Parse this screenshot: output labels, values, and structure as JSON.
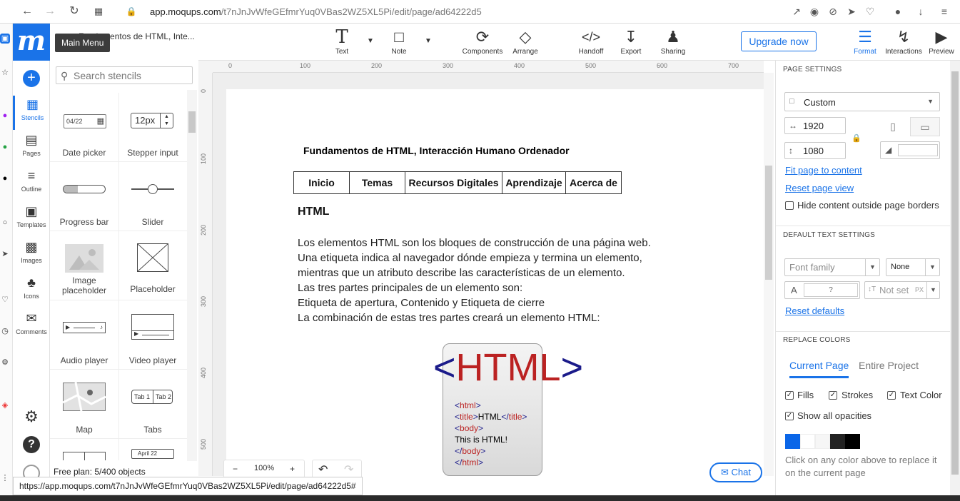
{
  "browser": {
    "url_host": "app.moqups.com",
    "url_path": "/t7nJnJvWfeGEfmrYuq0VBas2WZ5XL5Pi/edit/page/ad64222d5"
  },
  "app": {
    "doc_title": "Fundamentos de HTML, Inte...",
    "tooltip": "Main Menu",
    "search_placeholder": "Search stencils",
    "free_plan": "Free plan: 5/400 objects",
    "status_url": "https://app.moqups.com/t7nJnJvWfeGEfmrYuq0VBas2WZ5XL5Pi/edit/page/ad64222d5#"
  },
  "leftnav": {
    "items": [
      "Stencils",
      "Pages",
      "Outline",
      "Templates",
      "Images",
      "Icons",
      "Comments"
    ]
  },
  "stencils": [
    {
      "label": "Date picker",
      "preview": "04/22"
    },
    {
      "label": "Stepper input",
      "preview": "12px"
    },
    {
      "label": "Progress bar",
      "progress": 0.35
    },
    {
      "label": "Slider",
      "value": 0.5
    },
    {
      "label": "Image placeholder"
    },
    {
      "label": "Placeholder"
    },
    {
      "label": "Audio player"
    },
    {
      "label": "Video player"
    },
    {
      "label": "Map"
    },
    {
      "label": "Tabs",
      "tab1": "Tab 1",
      "tab2": "Tab 2"
    },
    {
      "label": "",
      "preview": ""
    },
    {
      "label": "",
      "preview": "April 22"
    }
  ],
  "toolbar": {
    "text": "Text",
    "note": "Note",
    "components": "Components",
    "arrange": "Arrange",
    "handoff": "Handoff",
    "export": "Export",
    "sharing": "Sharing",
    "upgrade": "Upgrade now",
    "format": "Format",
    "interactions": "Interactions",
    "preview": "Preview"
  },
  "ruler": {
    "h": [
      "0",
      "100",
      "200",
      "300",
      "400",
      "500",
      "600",
      "700"
    ],
    "v": [
      "0",
      "100",
      "200",
      "300",
      "400",
      "500"
    ]
  },
  "page": {
    "title": "Fundamentos de HTML, Interacción Humano Ordenador",
    "menu": [
      "Inicio",
      "Temas",
      "Recursos Digitales",
      "Aprendizaje",
      "Acerca de"
    ],
    "heading": "HTML",
    "body": [
      "Los elementos HTML son los bloques de construcción de una página web.",
      "Una etiqueta indica al navegador dónde empieza y termina un elemento,",
      "mientras que un atributo describe las características de un elemento.",
      "Las tres partes principales de un elemento son:",
      "Etiqueta de apertura, Contenido y Etiqueta de cierre",
      "La combinación de estas tres partes creará un elemento HTML:"
    ],
    "logo_text": "HTML",
    "code_text": "This is HTML!",
    "code_title": "HTML"
  },
  "zoom": "100%",
  "chat": "Chat",
  "rightpanel": {
    "page_settings": "PAGE SETTINGS",
    "size_preset": "Custom",
    "width": "1920",
    "height": "1080",
    "fit_page": "Fit page to content",
    "reset_view": "Reset page view",
    "hide_content": "Hide content outside page borders",
    "default_text": "DEFAULT TEXT SETTINGS",
    "font_family": "Font family",
    "font_style": "None",
    "font_size": "?",
    "line_height": "Not set",
    "line_unit": "PX",
    "reset_defaults": "Reset defaults",
    "replace_colors": "REPLACE COLORS",
    "tab_current": "Current Page",
    "tab_entire": "Entire Project",
    "fills": "Fills",
    "strokes": "Strokes",
    "text_color": "Text Color",
    "show_opacities": "Show all opacities",
    "hint": "Click on any color above to replace it on the current page",
    "swatches": [
      "#0a66e8",
      "#ffffff",
      "#f6f6f6",
      "#222222",
      "#000000"
    ]
  }
}
